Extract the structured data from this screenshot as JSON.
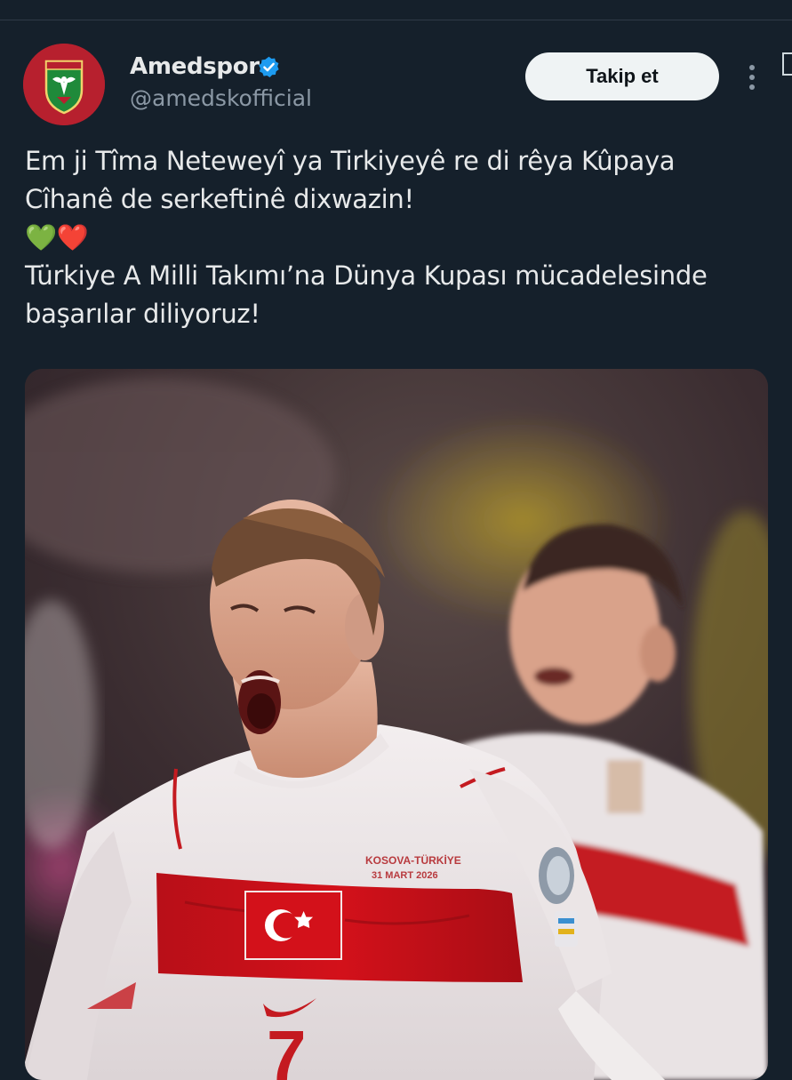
{
  "account": {
    "display_name": "Amedspor",
    "handle": "@amedskofficial",
    "verified": true,
    "avatar_icon": "amedspor-crest-icon",
    "avatar_color": "#b7202e"
  },
  "actions": {
    "follow_label": "Takip et",
    "more_icon": "more-options-icon"
  },
  "post": {
    "lines": [
      "Em ji Tîma Neteweyî ya Tirkiyeyê re di rêya Kûpaya",
      "Cîhanê de serkeftinê dixwazin!",
      "💚❤️",
      "Türkiye A Milli Takımı’na Dünya Kupası mücadelesinde",
      "başarılar diliyoruz!"
    ]
  },
  "media": {
    "jersey_text_line1": "KOSOVA-TÜRKİYE",
    "jersey_text_line2": "31 MART 2026",
    "jersey_number": "7"
  },
  "colors": {
    "background": "#15202b",
    "text": "#e7e9ea",
    "muted": "#8b98a5",
    "verified_blue": "#1d9bf0",
    "button_bg": "#eff3f4",
    "turkey_red": "#d3111a"
  }
}
